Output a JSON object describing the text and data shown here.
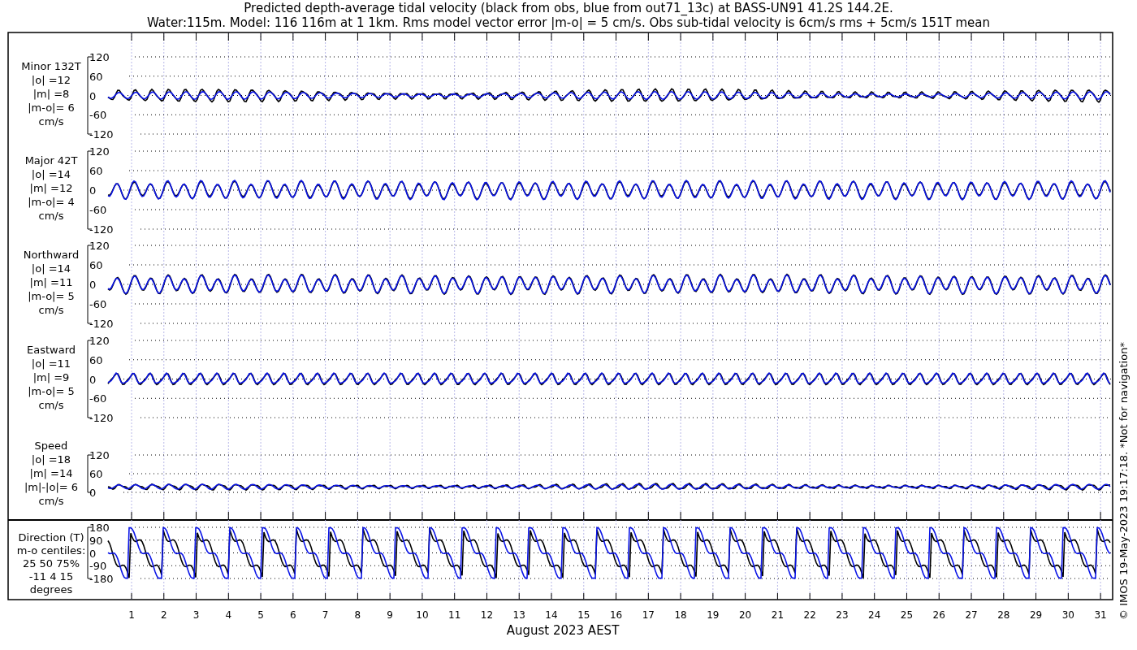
{
  "title": [
    "Predicted depth-average tidal velocity (black from obs, blue from out71_13c) at BASS-UN91 41.2S 144.2E.",
    "Water:115m. Model: 116 116m at 1 1km. Rms model vector error |m-o| = 5 cm/s. Obs sub-tidal velocity is 6cm/s rms + 5cm/s 151T mean"
  ],
  "panels": [
    {
      "kind": "minor",
      "label_lines": [
        "Minor 132T",
        "|o| =12",
        "|m| =8",
        "|m-o|= 6",
        "cm/s"
      ],
      "yticks": [
        "120",
        "60",
        "0",
        "-60",
        "-120"
      ]
    },
    {
      "kind": "major",
      "label_lines": [
        "Major 42T",
        "|o| =14",
        "|m| =12",
        "|m-o|= 4",
        "cm/s"
      ],
      "yticks": [
        "120",
        "60",
        "0",
        "-60",
        "-120"
      ]
    },
    {
      "kind": "northward",
      "label_lines": [
        "Northward",
        "|o| =14",
        "|m| =11",
        "|m-o|= 5",
        "cm/s"
      ],
      "yticks": [
        "120",
        "60",
        "0",
        "-60",
        "-120"
      ]
    },
    {
      "kind": "eastward",
      "label_lines": [
        "Eastward",
        "|o| =11",
        "|m| =9",
        "|m-o|= 5",
        "cm/s"
      ],
      "yticks": [
        "120",
        "60",
        "0",
        "-60",
        "-120"
      ]
    },
    {
      "kind": "speed",
      "label_lines": [
        "Speed",
        "|o| =18",
        "|m| =14",
        "|m|-|o|= 6",
        "cm/s"
      ],
      "yticks": [
        "120",
        "60",
        "0"
      ]
    },
    {
      "kind": "direction",
      "label_lines": [
        "Direction (T)",
        "m-o centiles:",
        "25  50  75%",
        "-11   4  15",
        "degrees"
      ],
      "yticks": [
        "180",
        "90",
        "0",
        "-90",
        "-180"
      ]
    }
  ],
  "x_axis": {
    "day_labels": [
      "1",
      "2",
      "3",
      "4",
      "5",
      "6",
      "7",
      "8",
      "9",
      "10",
      "11",
      "12",
      "13",
      "14",
      "15",
      "16",
      "17",
      "18",
      "19",
      "20",
      "21",
      "22",
      "23",
      "24",
      "25",
      "26",
      "27",
      "28",
      "29",
      "30",
      "31"
    ],
    "label": "August 2023 AEST"
  },
  "credit": "© IMOS 19-May-2023 19:17:18.  *Not for navigation*"
}
